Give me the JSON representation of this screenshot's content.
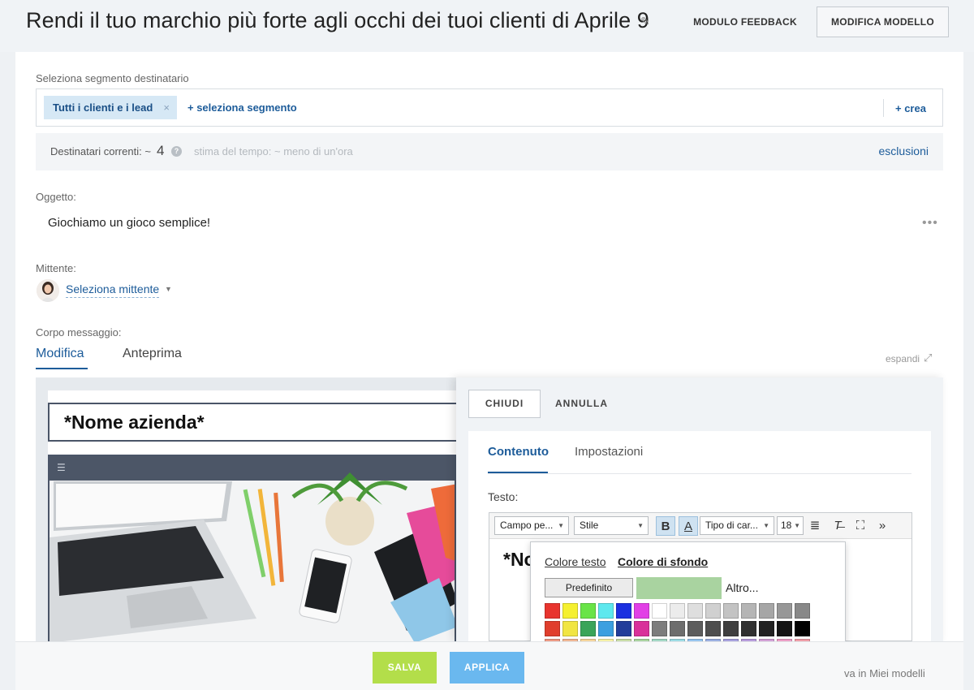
{
  "header": {
    "title": "Rendi il tuo marchio più forte agli occhi dei tuoi clienti di Aprile 9",
    "feedback_label": "MODULO FEEDBACK",
    "modify_template_label": "MODIFICA MODELLO"
  },
  "audience": {
    "label": "Seleziona segmento destinatario",
    "selected_segment": "Tutti i clienti e i lead",
    "add_segment_label": "+ seleziona segmento",
    "create_label": "+ crea",
    "recipients_label": "Destinatari correnti: ~",
    "recipients_count": "4",
    "time_estimate": "stima del tempo: ~ meno di un'ora",
    "exclusions_label": "esclusioni"
  },
  "subject": {
    "label": "Oggetto:",
    "value": "Giochiamo un gioco semplice!"
  },
  "sender": {
    "label": "Mittente:",
    "select_label": "Seleziona mittente"
  },
  "body": {
    "label": "Corpo messaggio:",
    "tabs": [
      "Modifica",
      "Anteprima"
    ],
    "expand_label": "espandi",
    "preview_company": "*Nome azienda*"
  },
  "side_panel": {
    "close_label": "CHIUDI",
    "cancel_label": "ANNULLA",
    "tabs": [
      "Contenuto",
      "Impostazioni"
    ],
    "text_label": "Testo:",
    "toolbar": {
      "field_select": "Campo pe...",
      "style_select": "Stile",
      "font_select": "Tipo di car...",
      "size_select": "18",
      "more": "»"
    },
    "editor_text": "*No"
  },
  "color_picker": {
    "tab_text_color": "Colore testo",
    "tab_bg_color": "Colore di sfondo",
    "default_label": "Predefinito",
    "more_label": "Altro...",
    "current_color": "#a9d3a0",
    "swatches": [
      [
        "#e8342e",
        "#f5f030",
        "#69e447",
        "#5ee8ee",
        "#1c30e0",
        "#e23fe6",
        "#ffffff",
        "#ececec",
        "#dedede",
        "#d0d0d0",
        "#c3c3c3",
        "#b5b5b5",
        "#a6a6a6",
        "#979797",
        "#888888"
      ],
      [
        "#e03e2d",
        "#f1e542",
        "#3aa459",
        "#3c9fe0",
        "#233d9a",
        "#d9309a",
        "#7d7d7d",
        "#6d6d6d",
        "#5d5d5d",
        "#4e4e4e",
        "#3f3f3f",
        "#303030",
        "#222222",
        "#141414",
        "#000000"
      ],
      [
        "#ec9a85",
        "#efb795",
        "#f5d59c",
        "#f5f0a8",
        "#c8dca8",
        "#a9d3a0",
        "#a4d8c5",
        "#9ddbe4",
        "#97c5ee",
        "#9bb0e1",
        "#a7a2dd",
        "#b79ddb",
        "#d2a1d5",
        "#eb9fc6",
        "#ee9ea8"
      ],
      [
        "#e66650",
        "#ea8f5a",
        "#f2ba60",
        "#f5ec70",
        "#a9cc70",
        "#74c477",
        "#6fcab0",
        "#61c4dd",
        "#5f9fe3",
        "#6080d2",
        "#7a71cf",
        "#9466cb",
        "#c06cc4",
        "#e069a8",
        "#e56879"
      ],
      [
        "#d63d2d",
        "#e26a2c",
        "#eea231",
        "#f2e43c",
        "#84b63e",
        "#3fae4a",
        "#3eb38f",
        "#2fa7c9",
        "#2973c9",
        "#2e4fb6",
        "#4a3fb3",
        "#6b3aad",
        "#a03da8",
        "#cf3b8c",
        "#d93c56"
      ]
    ]
  },
  "footer": {
    "save_label": "SALVA",
    "apply_label": "APPLICA",
    "save_template_label": "va in Miei modelli"
  }
}
